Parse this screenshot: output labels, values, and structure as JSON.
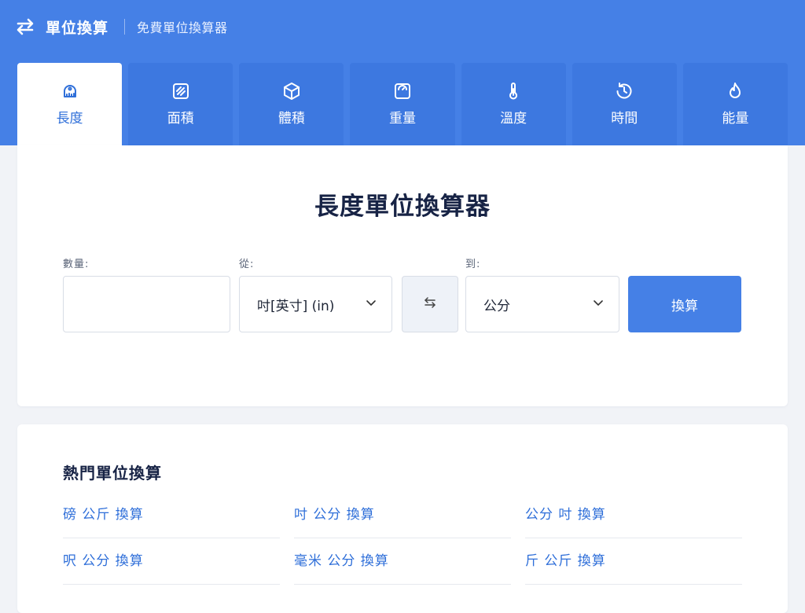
{
  "header": {
    "logo_icon": "swap-arrows-icon",
    "title": "單位換算",
    "subtitle": "免費單位換算器"
  },
  "tabs": [
    {
      "label": "長度",
      "icon": "ruler-icon",
      "active": true
    },
    {
      "label": "面積",
      "icon": "area-icon",
      "active": false
    },
    {
      "label": "體積",
      "icon": "cube-icon",
      "active": false
    },
    {
      "label": "重量",
      "icon": "scale-icon",
      "active": false
    },
    {
      "label": "溫度",
      "icon": "thermometer-icon",
      "active": false
    },
    {
      "label": "時間",
      "icon": "clock-history-icon",
      "active": false
    },
    {
      "label": "能量",
      "icon": "fire-icon",
      "active": false
    }
  ],
  "converter": {
    "title": "長度單位換算器",
    "quantity_label": "數量:",
    "quantity_value": "",
    "from_label": "從:",
    "from_value": "吋[英寸] (in)",
    "to_label": "到:",
    "to_value": "公分",
    "convert_label": "換算"
  },
  "popular": {
    "title": "熱門單位換算",
    "links": [
      "磅 公斤 換算",
      "吋 公分 換算",
      "公分 吋 換算",
      "呎 公分 換算",
      "毫米 公分 換算",
      "斤 公斤 換算"
    ]
  },
  "colors": {
    "primary": "#4580e6",
    "tab_bg": "#3d78e0",
    "link": "#2f6fd9",
    "title_text": "#172345"
  }
}
